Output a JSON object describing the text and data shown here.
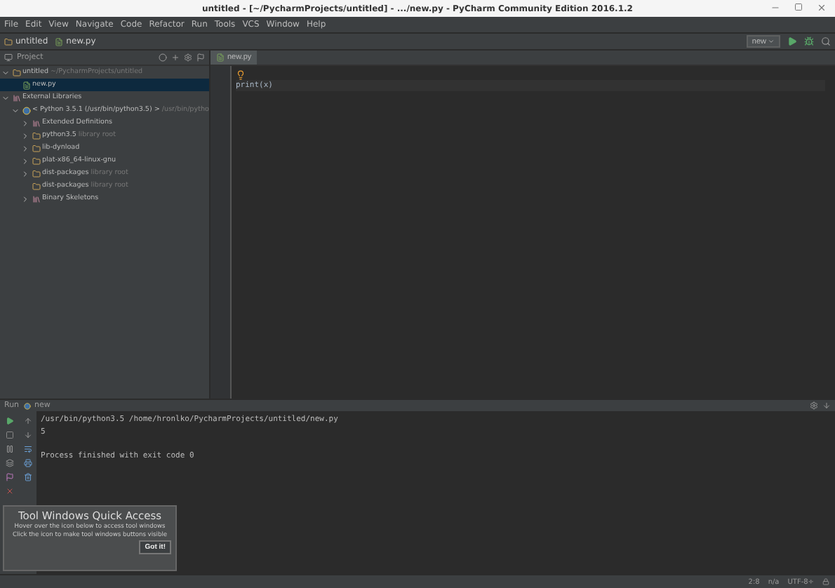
{
  "window": {
    "title": "untitled - [~/PycharmProjects/untitled] - .../new.py - PyCharm Community Edition 2016.1.2"
  },
  "menu": [
    "File",
    "Edit",
    "View",
    "Navigate",
    "Code",
    "Refactor",
    "Run",
    "Tools",
    "VCS",
    "Window",
    "Help"
  ],
  "breadcrumbs": [
    {
      "label": "untitled",
      "kind": "folder"
    },
    {
      "label": "new.py",
      "kind": "file"
    }
  ],
  "run_config": {
    "label": "new"
  },
  "project_panel": {
    "title": "Project",
    "tree": [
      {
        "label": "untitled",
        "hint": "~/PycharmProjects/untitled",
        "kind": "folder",
        "expanded": true,
        "selected": false,
        "children": [
          {
            "label": "new.py",
            "kind": "file",
            "selected": true
          }
        ]
      },
      {
        "label": "External Libraries",
        "kind": "library",
        "expanded": true,
        "selected": false,
        "children": [
          {
            "label": "< Python 3.5.1 (/usr/bin/python3.5) >",
            "hint": "/usr/bin/pytho",
            "kind": "python",
            "expanded": true,
            "selected": false,
            "children": [
              {
                "label": "Extended Definitions",
                "kind": "library",
                "expanded": false,
                "selected": false
              },
              {
                "label": "python3.5",
                "hint": "library root",
                "kind": "folder",
                "expanded": false,
                "selected": false
              },
              {
                "label": "lib-dynload",
                "kind": "folder",
                "expanded": false,
                "selected": false
              },
              {
                "label": "plat-x86_64-linux-gnu",
                "kind": "folder",
                "expanded": false,
                "selected": false
              },
              {
                "label": "dist-packages",
                "hint": "library root",
                "kind": "folder",
                "expanded": false,
                "selected": false
              },
              {
                "label": "dist-packages",
                "hint": "library root",
                "kind": "folder",
                "selected": false
              },
              {
                "label": "Binary Skeletons",
                "kind": "library",
                "expanded": false,
                "selected": false
              }
            ]
          }
        ]
      }
    ]
  },
  "editor": {
    "tabs": [
      {
        "label": "new.py",
        "selected": true
      }
    ],
    "lines": [
      {
        "kind": "bulb"
      },
      {
        "kind": "code",
        "text": "print(x)"
      }
    ]
  },
  "run_panel": {
    "title": "Run",
    "tab": "new",
    "console": [
      "/usr/bin/python3.5 /home/hronlko/PycharmProjects/untitled/new.py",
      "5"
    ],
    "exit_message": "Process finished with exit code 0"
  },
  "popup": {
    "title": "Tool Windows Quick Access",
    "lines": [
      "Hover over the icon below to access tool windows",
      "Click the icon to make tool windows buttons visible"
    ],
    "button": "Got it!"
  },
  "status_bar": [
    "2:8",
    "n/a",
    "UTF-8÷"
  ]
}
